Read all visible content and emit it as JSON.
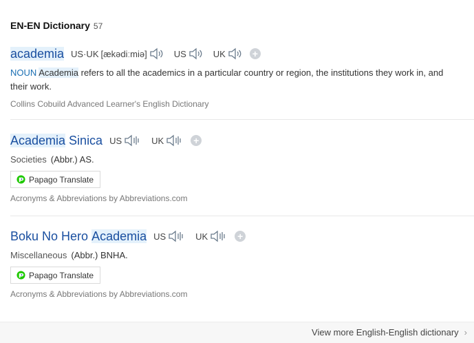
{
  "header": {
    "title": "EN-EN Dictionary",
    "count": "57"
  },
  "entries": [
    {
      "word_parts": [
        "academia"
      ],
      "pron": {
        "us_uk_label": "US·UK",
        "ipa": "[ækədiːmiə]",
        "us": "US",
        "uk": "UK"
      },
      "pos": "NOUN",
      "def_highlight": "Academia",
      "def_rest": " refers to all the academics in a particular country or region, the institutions they work in, and their work.",
      "source": "Collins Cobuild Advanced Learner's English Dictionary"
    },
    {
      "word_parts": [
        "Academia",
        "Sinica"
      ],
      "pron": {
        "us": "US",
        "uk": "UK"
      },
      "category": "Societies",
      "meaning": "(Abbr.) AS.",
      "papago": "Papago Translate",
      "source": "Acronyms & Abbreviations by Abbreviations.com"
    },
    {
      "word_parts": [
        "Boku No Hero",
        "Academia"
      ],
      "pron": {
        "us": "US",
        "uk": "UK"
      },
      "category": "Miscellaneous",
      "meaning": "(Abbr.) BNHA.",
      "papago": "Papago Translate",
      "source": "Acronyms & Abbreviations by Abbreviations.com"
    }
  ],
  "footer": {
    "more": "View more English-English dictionary"
  },
  "colors": {
    "link": "#1a4fa0",
    "highlight": "#e4f1fb",
    "pos": "#1a6fb3"
  },
  "icons": {
    "speaker": "speaker-icon",
    "add": "plus-icon",
    "papago": "papago-logo-icon",
    "chevron": "chevron-right-icon"
  }
}
